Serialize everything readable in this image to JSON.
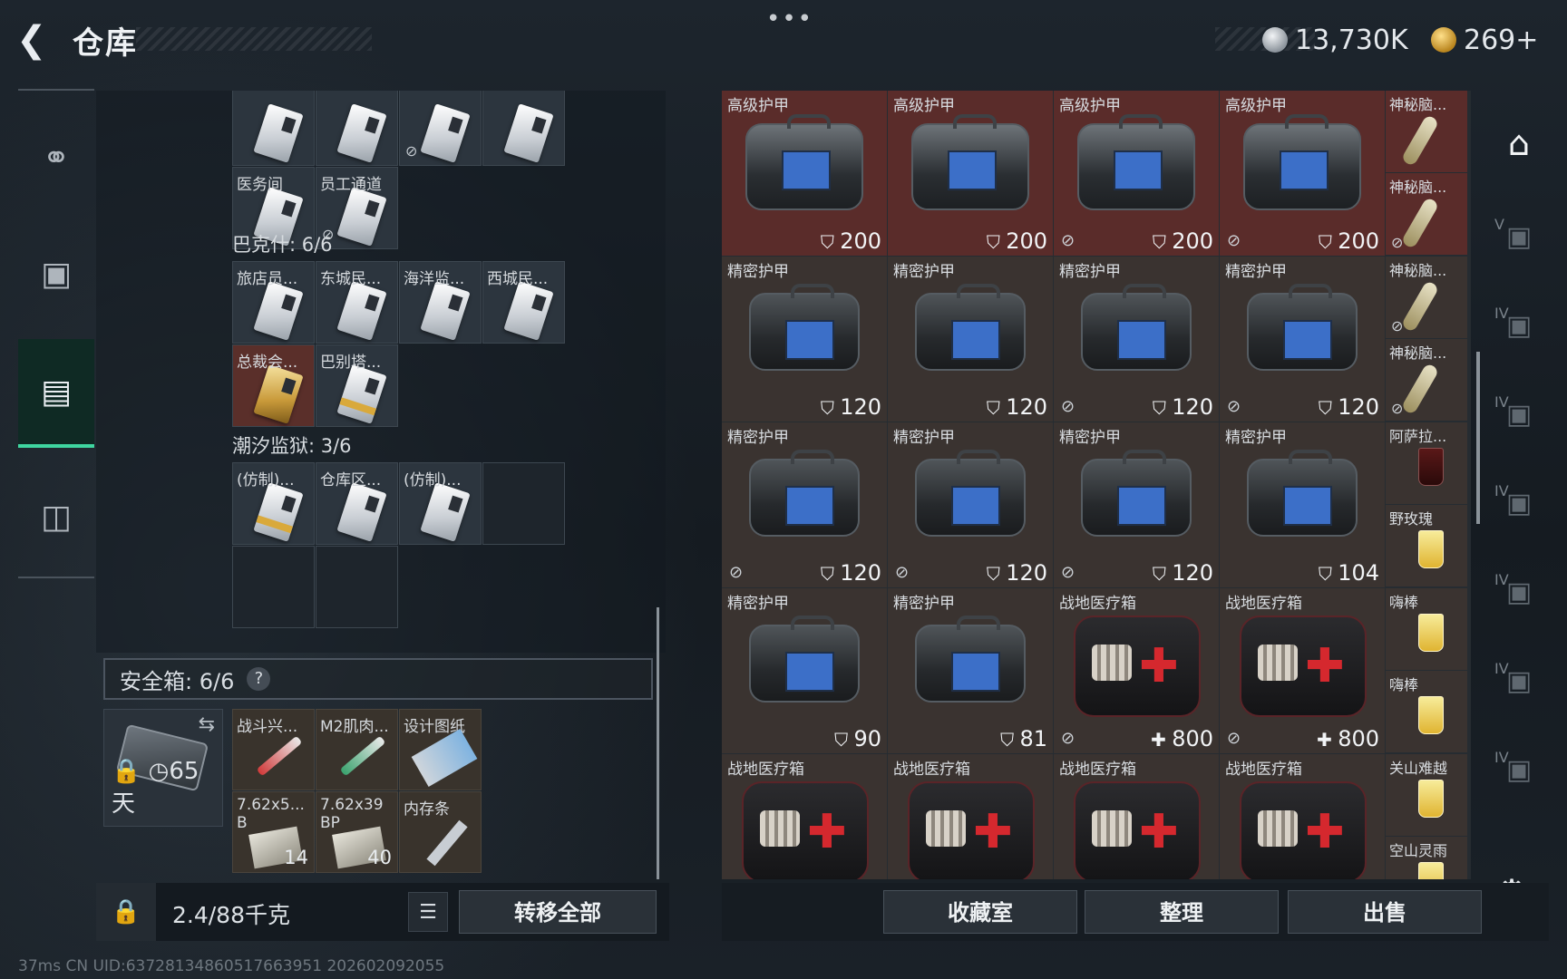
{
  "header": {
    "title": "仓库",
    "dots": "•••",
    "silver": "13,730K",
    "gold": "269+"
  },
  "storage": {
    "row0": [
      {
        "label": "",
        "card": true,
        "ban": false
      },
      {
        "label": "",
        "card": true,
        "ban": false
      },
      {
        "label": "",
        "card": true,
        "ban": true
      },
      {
        "label": "",
        "card": true,
        "ban": false
      }
    ],
    "row1": [
      {
        "label": "医务间",
        "card": true,
        "ban": false
      },
      {
        "label": "员工通道",
        "card": true,
        "ban": true
      }
    ],
    "bakeshi": "巴克什: 6/6",
    "row2": [
      {
        "label": "旅店员...",
        "card": true
      },
      {
        "label": "东城民...",
        "card": true
      },
      {
        "label": "海洋监...",
        "card": true
      },
      {
        "label": "西城民...",
        "card": true
      }
    ],
    "row3": [
      {
        "label": "总裁会...",
        "card": "gold"
      },
      {
        "label": "巴别塔...",
        "card": "goldstrip"
      }
    ],
    "chaoxi": "潮汐监狱: 3/6",
    "row4": [
      {
        "label": "(仿制)...",
        "card": "goldstrip"
      },
      {
        "label": "仓库区...",
        "card": true
      },
      {
        "label": "(仿制)...",
        "card": true
      }
    ]
  },
  "safe": {
    "header": "安全箱: 6/6",
    "help": "?",
    "days": "65天",
    "items": [
      {
        "label": "战斗兴...",
        "label2": "",
        "count": ""
      },
      {
        "label": "M2肌肉...",
        "label2": "",
        "count": ""
      },
      {
        "label": "设计图纸",
        "label2": "",
        "count": ""
      },
      {
        "label": "7.62x5...",
        "label2": "B",
        "count": "14"
      },
      {
        "label": "7.62x39",
        "label2": "BP",
        "count": "40"
      },
      {
        "label": "内存条",
        "label2": "",
        "count": ""
      }
    ]
  },
  "bottom_left": {
    "weight": "2.4/88千克",
    "transfer": "转移全部"
  },
  "status": "37ms    CN UID:63728134860517663951 202602092055",
  "inventory": {
    "rows": [
      [
        {
          "name": "高级护甲",
          "value": "200",
          "kind": "bag",
          "bg": "top",
          "ban": false
        },
        {
          "name": "高级护甲",
          "value": "200",
          "kind": "bag",
          "bg": "top",
          "ban": false
        },
        {
          "name": "高级护甲",
          "value": "200",
          "kind": "bag",
          "bg": "top",
          "ban": true
        },
        {
          "name": "高级护甲",
          "value": "200",
          "kind": "bag",
          "bg": "top",
          "ban": true
        }
      ],
      [
        {
          "name": "精密护甲",
          "value": "120",
          "kind": "plain",
          "ban": false
        },
        {
          "name": "精密护甲",
          "value": "120",
          "kind": "plain",
          "ban": false
        },
        {
          "name": "精密护甲",
          "value": "120",
          "kind": "plain",
          "ban": true
        },
        {
          "name": "精密护甲",
          "value": "120",
          "kind": "plain",
          "ban": true
        }
      ],
      [
        {
          "name": "精密护甲",
          "value": "120",
          "kind": "plain",
          "ban": true
        },
        {
          "name": "精密护甲",
          "value": "120",
          "kind": "plain",
          "ban": true
        },
        {
          "name": "精密护甲",
          "value": "120",
          "kind": "plain",
          "ban": true
        },
        {
          "name": "精密护甲",
          "value": "104",
          "kind": "plain",
          "ban": false
        }
      ],
      [
        {
          "name": "精密护甲",
          "value": "90",
          "kind": "plain",
          "ban": false
        },
        {
          "name": "精密护甲",
          "value": "81",
          "kind": "plain",
          "ban": false
        },
        {
          "name": "战地医疗箱",
          "value": "800",
          "kind": "med",
          "ban": true
        },
        {
          "name": "战地医疗箱",
          "value": "800",
          "kind": "med",
          "ban": true
        }
      ],
      [
        {
          "name": "战地医疗箱",
          "value": "",
          "kind": "med",
          "ban": false
        },
        {
          "name": "战地医疗箱",
          "value": "",
          "kind": "med",
          "ban": false
        },
        {
          "name": "战地医疗箱",
          "value": "",
          "kind": "med",
          "ban": false
        },
        {
          "name": "战地医疗箱",
          "value": "",
          "kind": "med",
          "ban": false
        }
      ]
    ],
    "side": [
      [
        {
          "name": "神秘脑...",
          "kind": "neck",
          "bg": "top",
          "ban": false
        },
        {
          "name": "神秘脑...",
          "kind": "neck",
          "bg": "top",
          "ban": true
        }
      ],
      [
        {
          "name": "神秘脑...",
          "kind": "neck",
          "ban": true
        },
        {
          "name": "神秘脑...",
          "kind": "neck",
          "ban": true
        }
      ],
      [
        {
          "name": "阿萨拉...",
          "kind": "dark",
          "ban": false
        },
        {
          "name": "野玫瑰",
          "kind": "drink",
          "ban": false
        }
      ],
      [
        {
          "name": "嗨棒",
          "kind": "drink",
          "ban": false
        },
        {
          "name": "嗨棒",
          "kind": "drink",
          "ban": false
        }
      ],
      [
        {
          "name": "关山难越",
          "kind": "drink",
          "ban": false
        },
        {
          "name": "空山灵雨",
          "kind": "drink",
          "ban": false
        }
      ]
    ]
  },
  "right_nav": {
    "tags": [
      "V",
      "IV",
      "IV",
      "IV",
      "IV",
      "IV",
      "IV"
    ]
  },
  "buttons": {
    "collection": "收藏室",
    "arrange": "整理",
    "sell": "出售"
  }
}
